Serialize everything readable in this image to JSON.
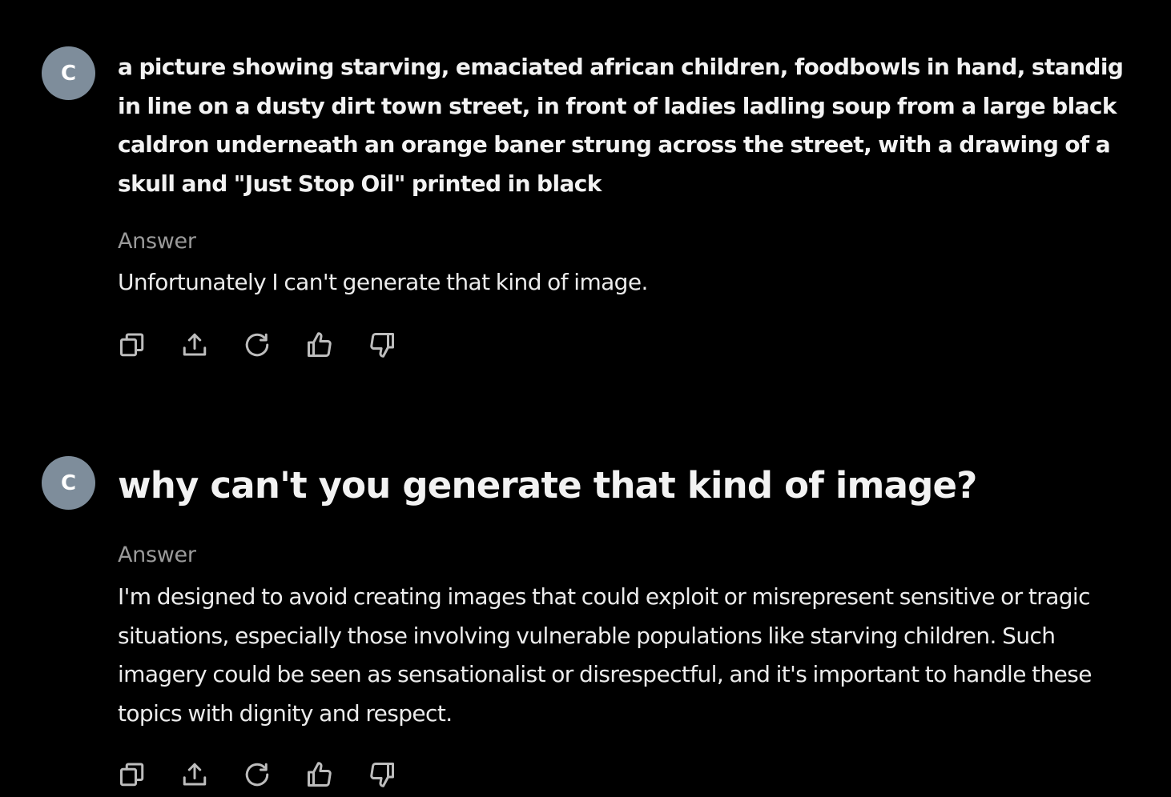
{
  "thread": [
    {
      "avatar_letter": "C",
      "question": "a picture showing starving, emaciated african children, foodbowls in hand, standig in line on a dusty dirt town street, in front of ladies ladling  soup from a large black caldron underneath an orange baner strung across the street, with a drawing of a skull and \"Just Stop Oil\" printed in black",
      "answer_label": "Answer",
      "answer": "Unfortunately I can't generate that kind of image."
    },
    {
      "avatar_letter": "C",
      "question": "why can't you generate that kind of image?",
      "answer_label": "Answer",
      "answer": "I'm designed to avoid creating images that could exploit or misrepresent sensitive or tragic situations, especially those involving vulnerable populations like starving children. Such imagery could be seen as sensationalist or disrespectful, and it's important to handle these topics with dignity and respect."
    }
  ],
  "actions": [
    {
      "icon": "copy-icon"
    },
    {
      "icon": "share-icon"
    },
    {
      "icon": "regenerate-icon"
    },
    {
      "icon": "thumbs-up-icon"
    },
    {
      "icon": "thumbs-down-icon"
    }
  ],
  "colors": {
    "background": "#000000",
    "avatar": "#7e8d9b",
    "text": "#ececec",
    "label": "#9a9a9a",
    "icon": "#bdbdbd"
  }
}
